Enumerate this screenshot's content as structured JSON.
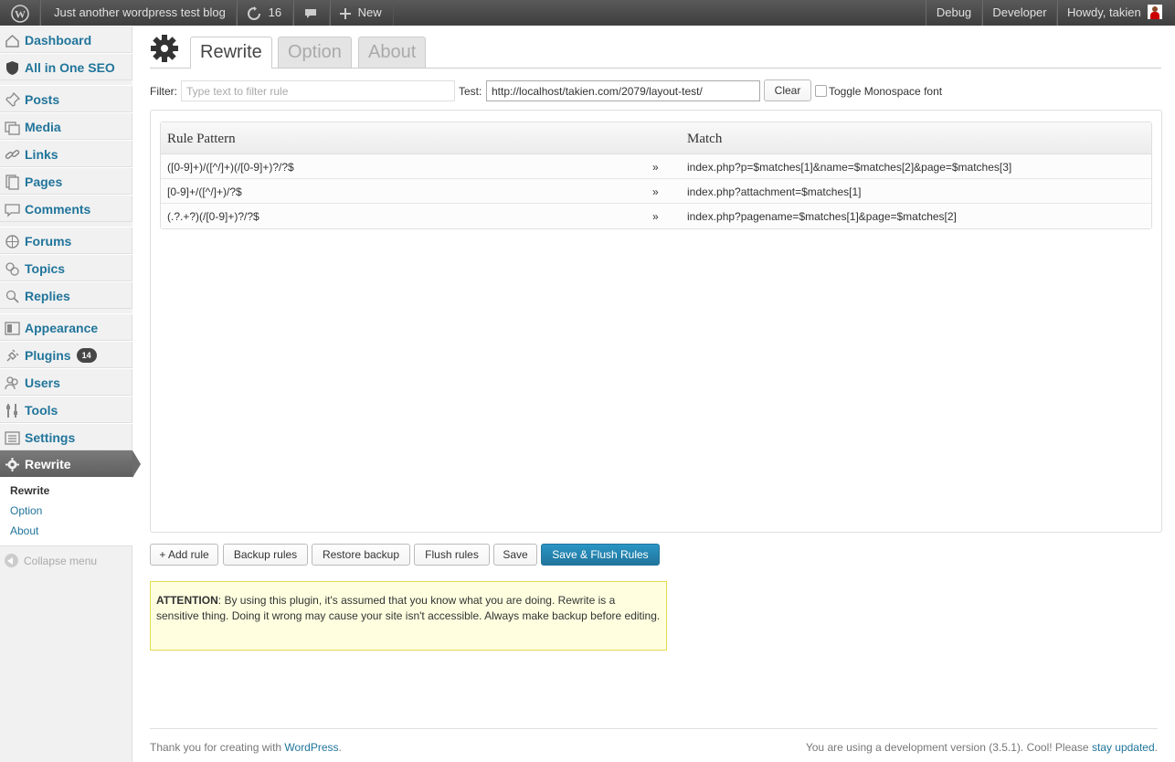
{
  "adminbar": {
    "site_name": "Just another wordpress test blog",
    "updates_count": "16",
    "new_label": "New",
    "debug_label": "Debug",
    "developer_label": "Developer",
    "howdy_label": "Howdy, takien"
  },
  "sidebar": {
    "items": [
      {
        "label": "Dashboard",
        "icon": "dashboard-icon"
      },
      {
        "label": "All in One SEO",
        "icon": "shield-icon"
      },
      {
        "label": "Posts",
        "icon": "pin-icon"
      },
      {
        "label": "Media",
        "icon": "media-icon"
      },
      {
        "label": "Links",
        "icon": "link-icon"
      },
      {
        "label": "Pages",
        "icon": "pages-icon"
      },
      {
        "label": "Comments",
        "icon": "comment-icon"
      },
      {
        "label": "Forums",
        "icon": "forum-icon"
      },
      {
        "label": "Topics",
        "icon": "topics-icon"
      },
      {
        "label": "Replies",
        "icon": "replies-icon"
      },
      {
        "label": "Appearance",
        "icon": "appearance-icon"
      },
      {
        "label": "Plugins",
        "icon": "plugin-icon",
        "badge": "14"
      },
      {
        "label": "Users",
        "icon": "users-icon"
      },
      {
        "label": "Tools",
        "icon": "tools-icon"
      },
      {
        "label": "Settings",
        "icon": "settings-icon"
      },
      {
        "label": "Rewrite",
        "icon": "gear-icon"
      }
    ],
    "submenu": [
      {
        "label": "Rewrite"
      },
      {
        "label": "Option"
      },
      {
        "label": "About"
      }
    ],
    "collapse_label": "Collapse menu"
  },
  "tabs": [
    {
      "label": "Rewrite"
    },
    {
      "label": "Option"
    },
    {
      "label": "About"
    }
  ],
  "filter": {
    "filter_label": "Filter:",
    "filter_placeholder": "Type text to filter rule",
    "test_label": "Test:",
    "test_value": "http://localhost/takien.com/2079/layout-test/",
    "clear_label": "Clear",
    "monospace_label": "Toggle Monospace font"
  },
  "table": {
    "headers": {
      "pattern": "Rule Pattern",
      "match": "Match"
    },
    "arrow": "»",
    "rows": [
      {
        "pattern": "([0-9]+)/([^/]+)(/[0-9]+)?/?$",
        "match": "index.php?p=$matches[1]&name=$matches[2]&page=$matches[3]"
      },
      {
        "pattern": "[0-9]+/([^/]+)/?$",
        "match": "index.php?attachment=$matches[1]"
      },
      {
        "pattern": "(.?.+?)(/[0-9]+)?/?$",
        "match": "index.php?pagename=$matches[1]&page=$matches[2]"
      }
    ]
  },
  "actions": {
    "add_rule": "+ Add rule",
    "backup": "Backup rules",
    "restore": "Restore backup",
    "flush": "Flush rules",
    "save": "Save",
    "save_flush": "Save & Flush Rules"
  },
  "attention": {
    "title": "ATTENTION",
    "text": ": By using this plugin, it's assumed that you know what you are doing. Rewrite is a sensitive thing. Doing it wrong may cause your site isn't accessible. Always make backup before editing."
  },
  "footer": {
    "left_text": "Thank you for creating with ",
    "left_link": "WordPress",
    "left_end": ".",
    "right_text": "You are using a development version (3.5.1). Cool! Please ",
    "right_link": "stay updated",
    "right_end": "."
  }
}
